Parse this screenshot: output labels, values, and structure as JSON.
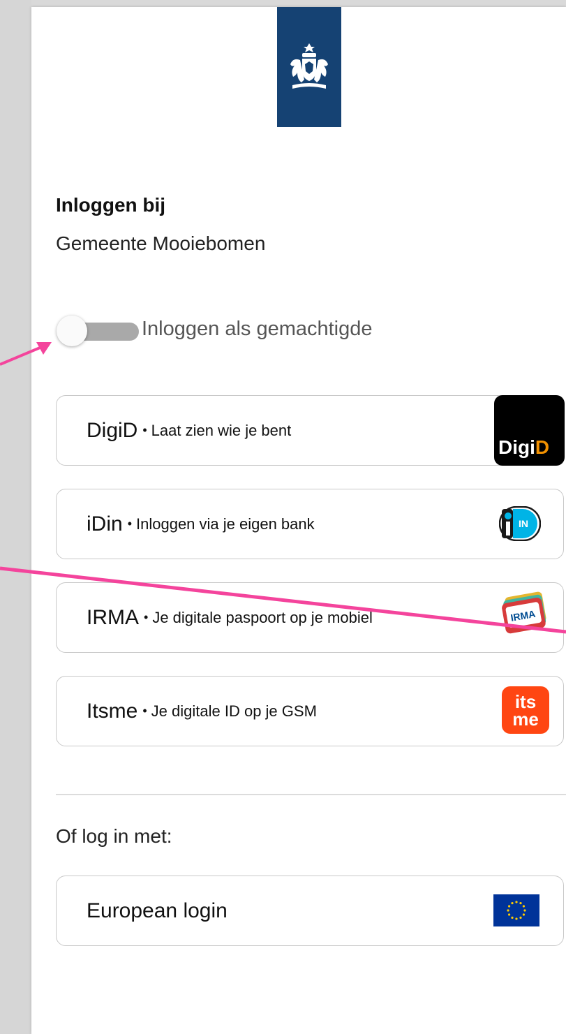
{
  "header": {
    "logo_icon": "rijksoverheid-coat-of-arms-icon",
    "logo_color": "#154273"
  },
  "login": {
    "title": "Inloggen bij",
    "organisation": "Gemeente Mooiebomen"
  },
  "toggle": {
    "label": "Inloggen als gemachtigde",
    "state": "off"
  },
  "methods": [
    {
      "label": "DigiD",
      "separator": "•",
      "description": "Laat zien wie je bent",
      "icon": "digid-logo-icon",
      "badge_text_a": "Digi",
      "badge_text_b": "D"
    },
    {
      "label": "iDin",
      "separator": "•",
      "description": "Inloggen via je eigen bank",
      "icon": "idin-logo-icon",
      "badge_text": "IN"
    },
    {
      "label": "IRMA",
      "separator": "•",
      "description": "Je digitale paspoort op je mobiel",
      "icon": "irma-logo-icon",
      "badge_text": "IRMA"
    },
    {
      "label": "Itsme",
      "separator": "•",
      "description": "Je digitale ID op je GSM",
      "icon": "itsme-logo-icon",
      "badge_text_a": "its",
      "badge_text_b": "me"
    }
  ],
  "alternative": {
    "heading": "Of log in met:",
    "european_label": "European login",
    "european_icon": "eu-flag-icon"
  },
  "annotation_color": "#f4449c"
}
